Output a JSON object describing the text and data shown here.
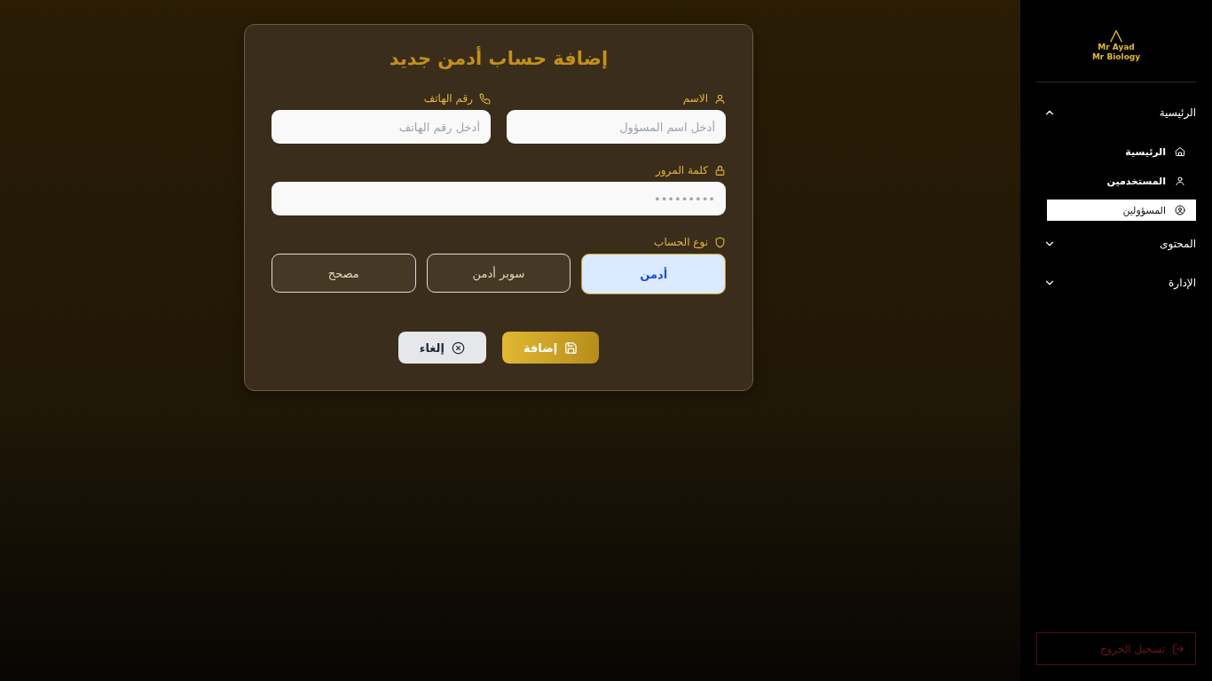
{
  "form": {
    "title": "إضافة حساب أدمن جديد",
    "fields": [
      {
        "label": "الاسم",
        "placeholder": "أدخل اسم المسؤول"
      },
      {
        "label": "رقم الهاتف",
        "placeholder": "أدخل رقم الهاتف"
      }
    ],
    "password": {
      "label": "كلمة المرور",
      "placeholder": "•••••••••"
    },
    "account_type": {
      "label": "نوع الحساب",
      "options": [
        {
          "label": "أدمن",
          "selected": true
        },
        {
          "label": "سوبر أدمن",
          "selected": false
        },
        {
          "label": "مصحح",
          "selected": false
        }
      ]
    },
    "buttons": [
      {
        "kind": "primary",
        "label": "إضافة"
      },
      {
        "kind": "secondary",
        "label": "إلغاء"
      }
    ]
  },
  "sidebar": {
    "logo": {
      "lines": [
        "Mr Ayad",
        "Mr Biology"
      ]
    },
    "groups": [
      {
        "label": "الرئيسية",
        "expanded": true,
        "children": [
          {
            "label": "الرئيسية",
            "selected": false
          },
          {
            "label": "المستخدمين",
            "selected": false
          },
          {
            "label": "المسؤولين",
            "selected": true
          }
        ]
      },
      {
        "label": "المحتوى",
        "expanded": false
      },
      {
        "label": "الإدارة",
        "expanded": false
      }
    ],
    "logout": "تسجيل الخروج"
  }
}
